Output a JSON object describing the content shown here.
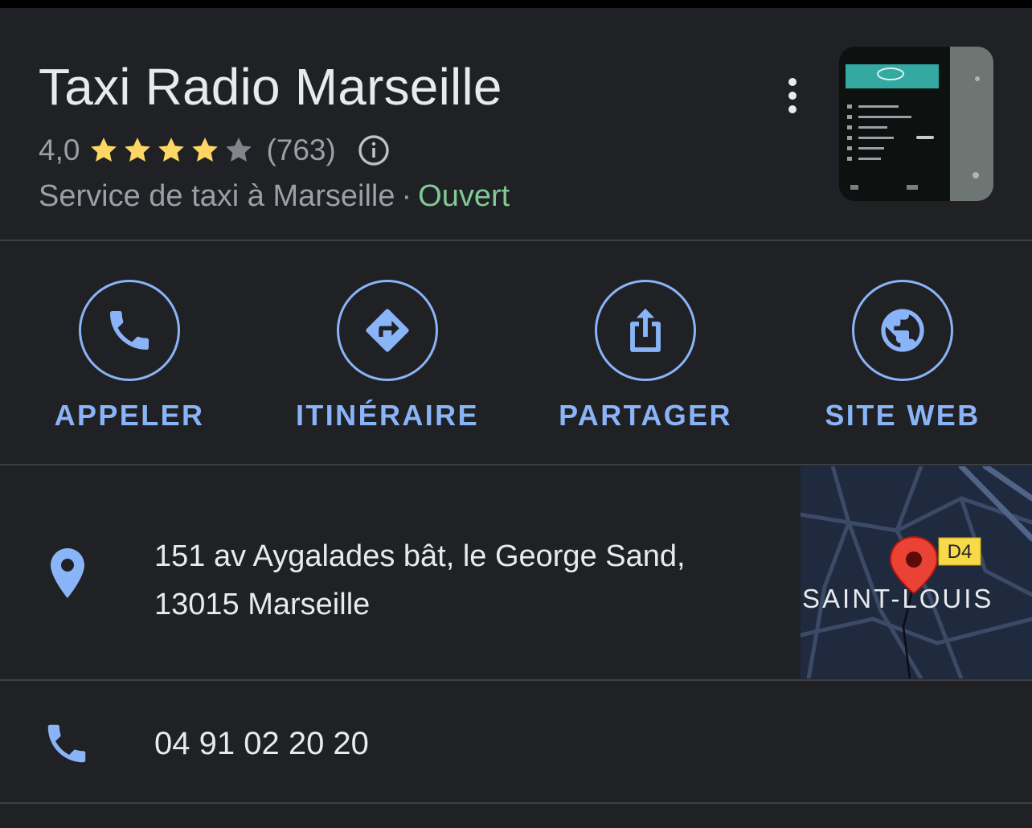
{
  "place": {
    "name": "Taxi Radio Marseille",
    "rating": "4,0",
    "stars": 4,
    "reviews": "(763)",
    "category": "Service de taxi à Marseille",
    "separator": "·",
    "status": "Ouvert"
  },
  "colors": {
    "accent": "#8ab4f8",
    "open": "#81c995",
    "star": "#fdd663",
    "background": "#202124"
  },
  "actions": [
    {
      "label": "APPELER",
      "icon": "phone-icon"
    },
    {
      "label": "ITINÉRAIRE",
      "icon": "directions-icon"
    },
    {
      "label": "PARTAGER",
      "icon": "share-icon"
    },
    {
      "label": "SITE WEB",
      "icon": "globe-icon"
    }
  ],
  "address": {
    "line1": "151 av Aygalades bât, le George Sand,",
    "line2": "13015 Marseille",
    "icon": "location-pin-icon"
  },
  "map": {
    "area_label": "SAINT-LOUIS",
    "road_label": "D4"
  },
  "phone": {
    "number": "04 91 02 20 20",
    "icon": "phone-icon"
  }
}
